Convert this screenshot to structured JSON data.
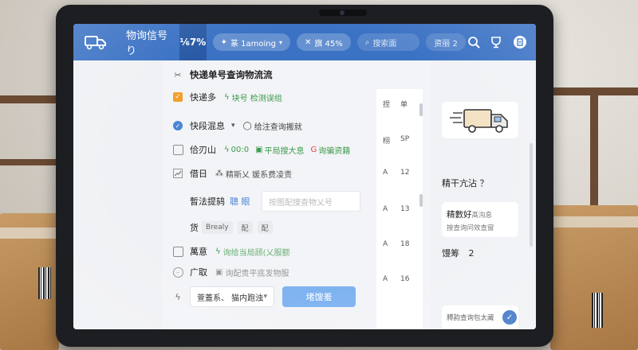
{
  "header": {
    "app_title": "物询信号り",
    "percent_tab": "⅙7%",
    "pill_filter": "篆 1amoing",
    "pill_ratio": "旗 45%",
    "search_placeholder": "搜索面",
    "pill_settings": "资丽 2"
  },
  "form": {
    "title_row": "快递单号查询物流流",
    "row_courier": {
      "label": "快递多",
      "tag": "块号 检测误组"
    },
    "row_status": {
      "label": "快段混息",
      "tag": "给注查询搬就"
    },
    "row_time": {
      "label": "佮刃山",
      "tag_1": "00:0",
      "tag_2": "平局搜大息",
      "tag_3": "询骗资籍"
    },
    "row_info": {
      "label": "借日",
      "tag": "精斯乂 媛系费凌责"
    },
    "row_query": {
      "label": "暫法提鸫",
      "link": "聰 眼",
      "placeholder": "按图配搜查物乂号"
    },
    "row_chips": {
      "label": "货",
      "chip_1": "Brealy",
      "chip_2": "配",
      "chip_3": "配"
    },
    "row_note": {
      "label": "萬意",
      "tag": "询给当局顾(乂服额"
    },
    "row_extra": {
      "label": "广取",
      "tag": "询配贵平底发物服"
    },
    "select_value": "萱蓋系、 猫内跑浊",
    "submit_label": "堵馊羞"
  },
  "minicol": {
    "header_1": "捏",
    "header_2": "单",
    "sub_1": "栩",
    "sub_2": "SP",
    "rows": [
      {
        "label": "A",
        "value": "12"
      },
      {
        "label": "A",
        "value": "13"
      },
      {
        "label": "A",
        "value": "18"
      },
      {
        "label": "A",
        "value": "16"
      }
    ]
  },
  "right_panel": {
    "heading": "精干亢沾 ？",
    "card_title": "精數好",
    "card_title_suffix": "髙沟息",
    "card_sub": "按查询问效查窗",
    "count_label": "馒筹",
    "count_value": "2",
    "bottom_text": "膊韵查询包太藏"
  },
  "colors": {
    "header_bg": "#3b72c4",
    "accent_green": "#3a9a4a",
    "primary_button": "#7fb3f0",
    "checkbox_orange": "#f2a12c"
  }
}
